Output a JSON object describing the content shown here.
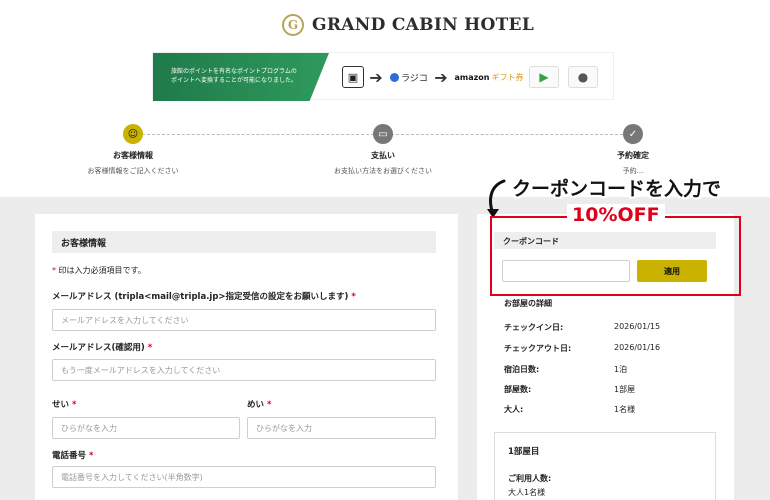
{
  "hotel": {
    "name": "GRAND CABIN HOTEL",
    "logo_letter": "G"
  },
  "banner": {
    "text_lines": [
      "旅館のポイントを有名なポイントプログラムの",
      "ポイントへ変換することが可能になりました。"
    ],
    "rajiko_label": "ラジコ",
    "amazon_label": "amazon",
    "amazon_gift_label": "ギフト券"
  },
  "steps": [
    {
      "title": "お客様情報",
      "subtitle": "お客様情報をご記入ください"
    },
    {
      "title": "支払い",
      "subtitle": "お支払い方法をお選びください"
    },
    {
      "title": "予約確定",
      "subtitle": "予約..."
    }
  ],
  "form": {
    "section_title": "お客様情報",
    "required_note": "印は入力必須項目です。",
    "required_mark": "*",
    "email_label": "メールアドレス (tripla<mail@tripla.jp>指定受信の設定をお願いします)",
    "email_placeholder": "メールアドレスを入力してください",
    "email_confirm_label": "メールアドレス(確認用)",
    "email_confirm_placeholder": "もう一度メールアドレスを入力してください",
    "sei_label": "せい",
    "sei_placeholder": "ひらがなを入力",
    "mei_label": "めい",
    "mei_placeholder": "ひらがなを入力",
    "phone_label": "電話番号",
    "phone_placeholder": "電話番号を入力してください(半角数字)"
  },
  "coupon": {
    "title": "クーポンコード",
    "value": "",
    "apply_label": "適用"
  },
  "room_details": {
    "title": "お部屋の詳細",
    "rows": [
      {
        "label": "チェックイン日:",
        "value": "2026/01/15"
      },
      {
        "label": "チェックアウト日:",
        "value": "2026/01/16"
      },
      {
        "label": "宿泊日数:",
        "value": "1泊"
      },
      {
        "label": "部屋数:",
        "value": "1部屋"
      },
      {
        "label": "大人:",
        "value": "1名様"
      }
    ],
    "room_title": "1部屋目",
    "guests_label": "ご利用人数:",
    "guests_value": "大人1名様"
  },
  "annotation": {
    "callout": "クーポンコードを入力で",
    "promo": "10%OFF",
    "accent_color": "#e0001b"
  },
  "colors": {
    "brand_gold": "#c9b300",
    "banner_green": "#2f9a5c"
  }
}
